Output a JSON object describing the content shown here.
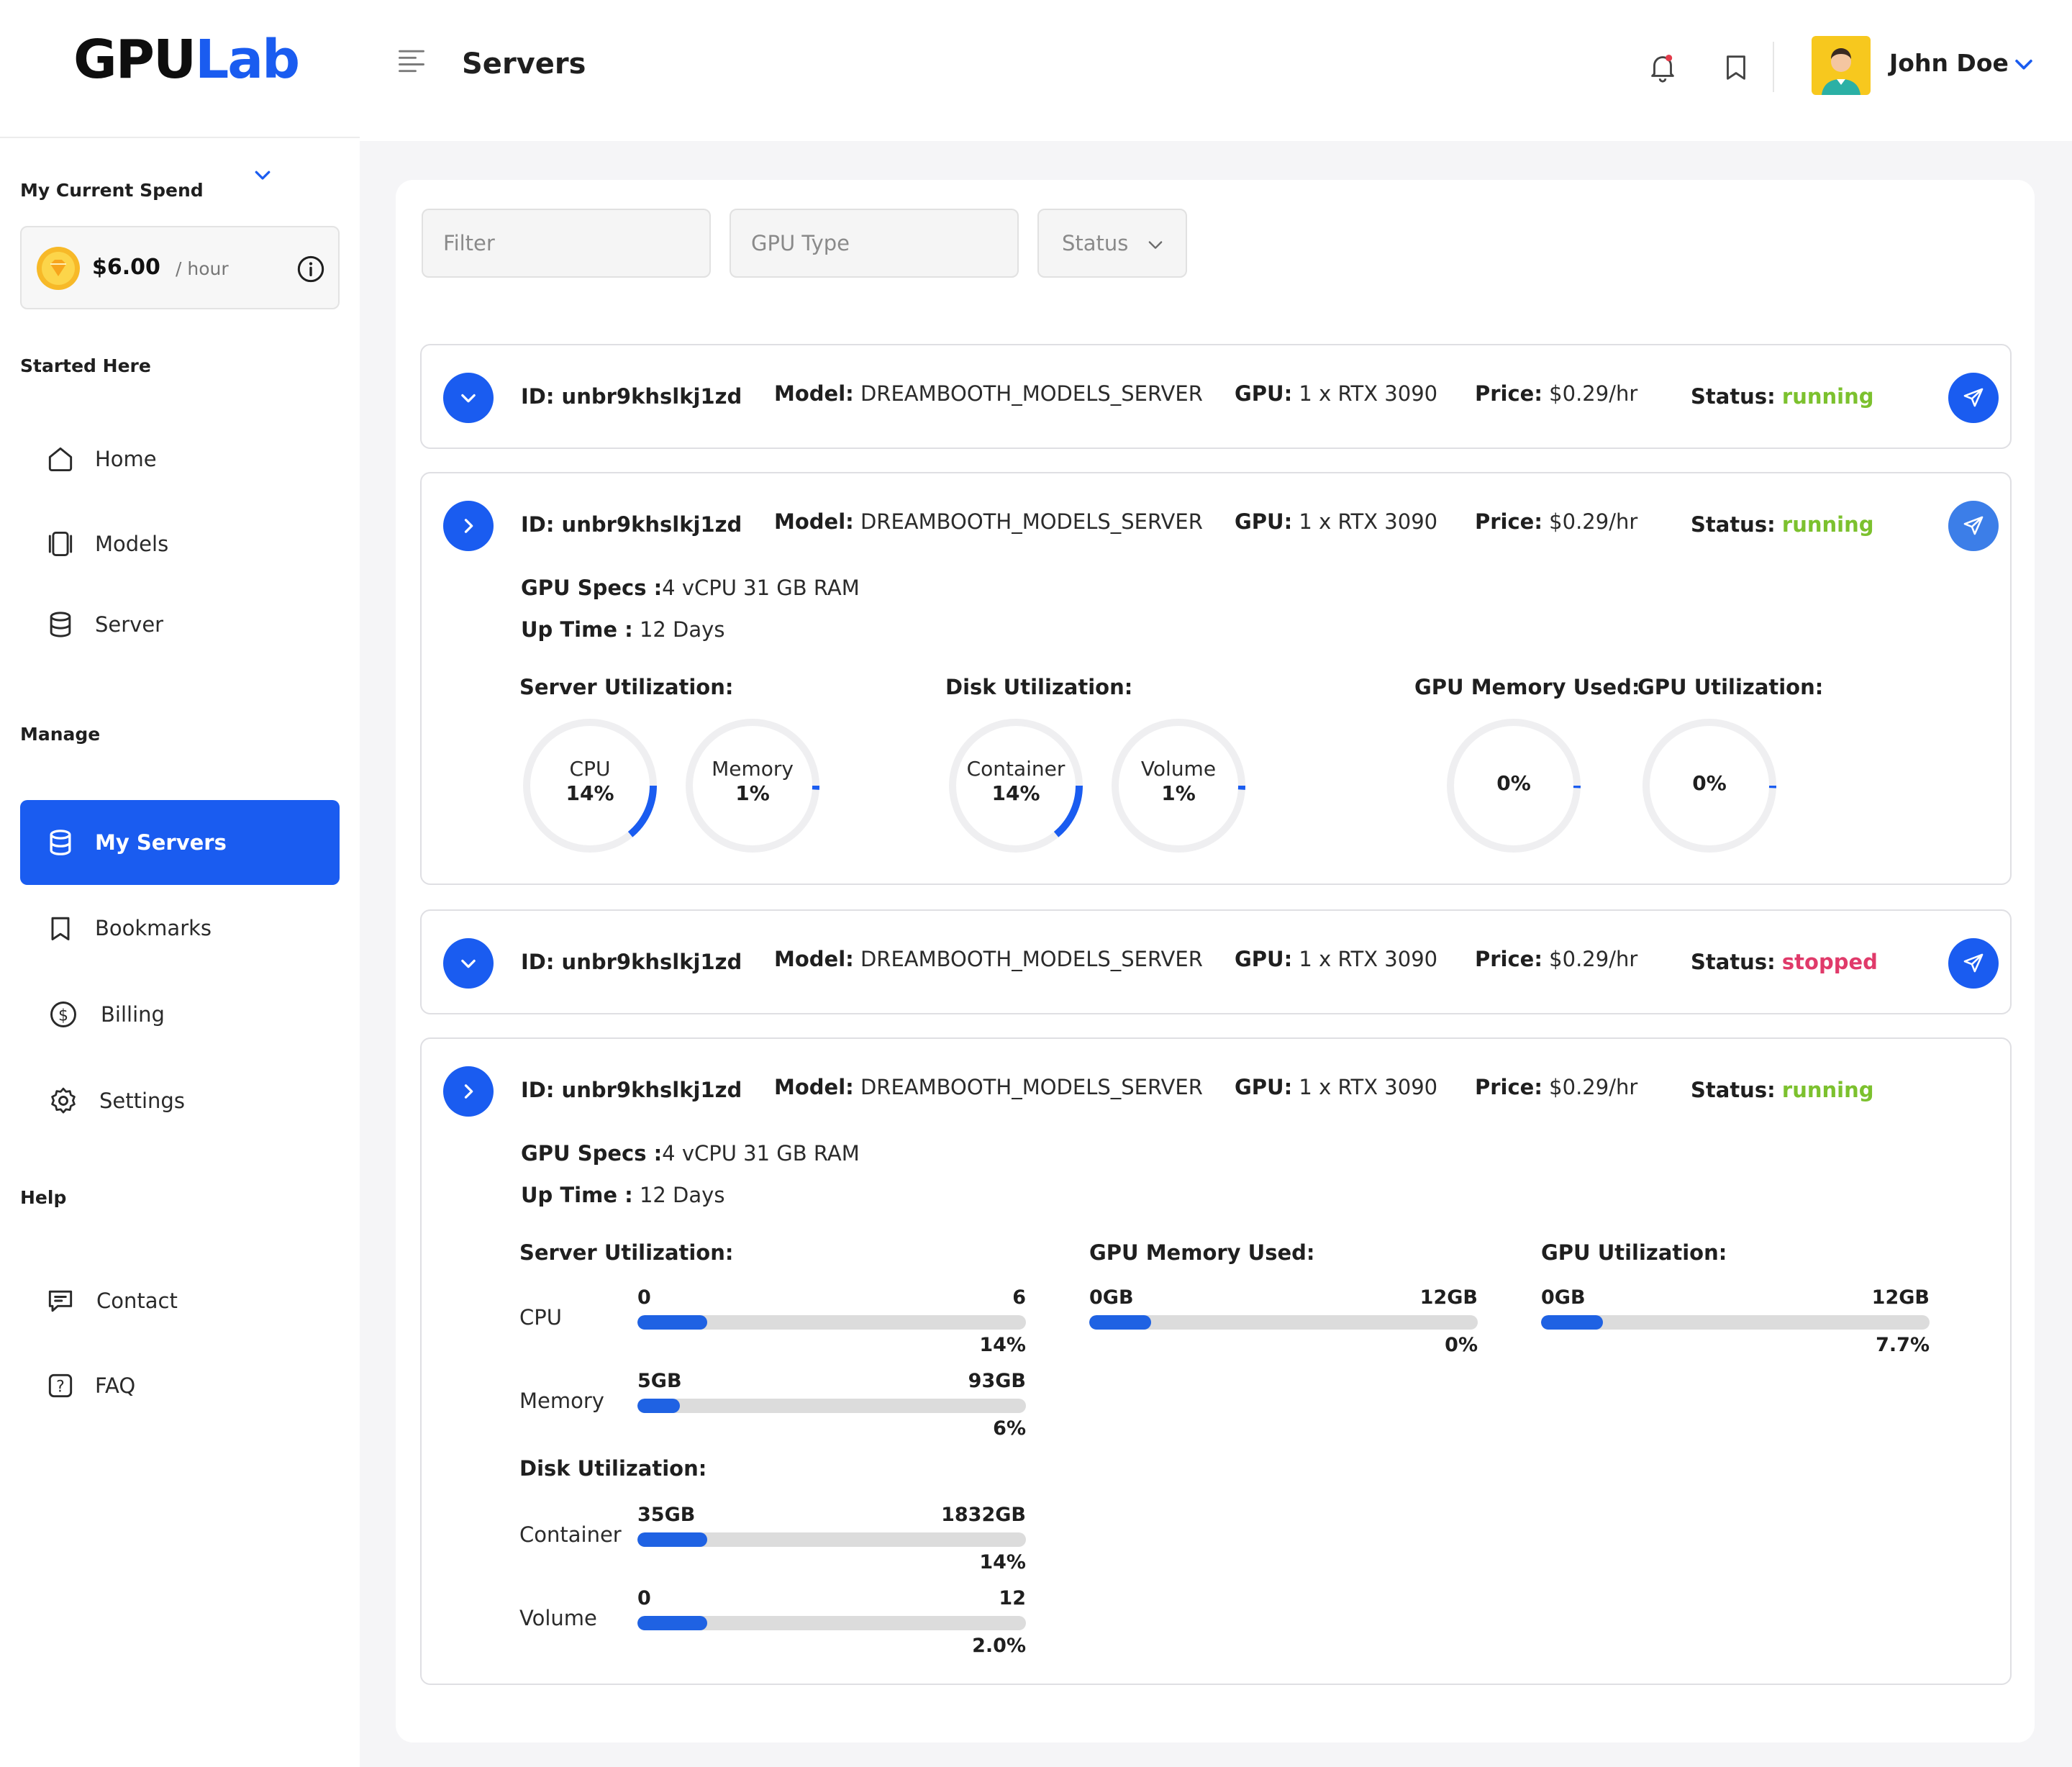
{
  "brand": {
    "name_part1": "GPU",
    "name_part2": "Lab"
  },
  "header": {
    "title": "Servers",
    "user_name": "John Doe"
  },
  "spend": {
    "title": "My Current Spend",
    "amount": "$6.00",
    "unit": "/ hour"
  },
  "sidebar": {
    "started_label": "Started Here",
    "manage_label": "Manage",
    "help_label": "Help",
    "items": [
      {
        "label": "Home",
        "icon": "home-icon"
      },
      {
        "label": "Models",
        "icon": "models-icon"
      },
      {
        "label": "Server",
        "icon": "database-icon"
      },
      {
        "label": "My Servers",
        "icon": "database-icon",
        "active": true
      },
      {
        "label": "Bookmarks",
        "icon": "bookmark-icon"
      },
      {
        "label": "Billing",
        "icon": "dollar-icon"
      },
      {
        "label": "Settings",
        "icon": "gear-icon"
      },
      {
        "label": "Contact",
        "icon": "chat-icon"
      },
      {
        "label": "FAQ",
        "icon": "question-icon"
      }
    ]
  },
  "filters": {
    "filter_placeholder": "Filter",
    "gpu_type_placeholder": "GPU Type",
    "status_label": "Status"
  },
  "labels": {
    "model": "Model:",
    "gpu": "GPU:",
    "price": "Price:",
    "status": "Status:",
    "gpu_specs": "GPU Specs :",
    "up_time": "Up Time :",
    "server_util": "Server Utilization:",
    "disk_util": "Disk Utilization:",
    "gpu_mem_used": "GPU Memory Used:",
    "gpu_util": "GPU Utilization:"
  },
  "servers": [
    {
      "id": "ID: unbr9khslkj1zd",
      "model": "DREAMBOOTH_MODELS_SERVER",
      "gpu": "1 x RTX 3090",
      "price": "$0.29/hr",
      "status": "running"
    },
    {
      "id": "ID: unbr9khslkj1zd",
      "model": "DREAMBOOTH_MODELS_SERVER",
      "gpu": "1 x RTX 3090",
      "price": "$0.29/hr",
      "status": "running",
      "gpu_specs": "4 vCPU 31 GB RAM",
      "up_time": "12 Days",
      "gauges": {
        "cpu": {
          "label": "CPU",
          "value": "14%",
          "fraction": 0.14
        },
        "memory": {
          "label": "Memory",
          "value": "1%",
          "fraction": 0.01
        },
        "container": {
          "label": "Container",
          "value": "14%",
          "fraction": 0.14
        },
        "volume": {
          "label": "Volume",
          "value": "1%",
          "fraction": 0.01
        },
        "gpu_memory": {
          "value": "0%",
          "fraction": 0.0
        },
        "gpu_util": {
          "value": "0%",
          "fraction": 0.0
        }
      }
    },
    {
      "id": "ID: unbr9khslkj1zd",
      "model": "DREAMBOOTH_MODELS_SERVER",
      "gpu": "1 x RTX 3090",
      "price": "$0.29/hr",
      "status": "stopped"
    },
    {
      "id": "ID: unbr9khslkj1zd",
      "model": "DREAMBOOTH_MODELS_SERVER",
      "gpu": "1 x RTX 3090",
      "price": "$0.29/hr",
      "status": "running",
      "gpu_specs": "4 vCPU 31 GB RAM",
      "up_time": "12 Days",
      "bars": {
        "cpu": {
          "label": "CPU",
          "min": "0",
          "max": "6",
          "pct": "14%",
          "fraction": 0.18
        },
        "memory": {
          "label": "Memory",
          "min": "5GB",
          "max": "93GB",
          "pct": "6%",
          "fraction": 0.11
        },
        "container": {
          "label": "Container",
          "min": "35GB",
          "max": "1832GB",
          "pct": "14%",
          "fraction": 0.18
        },
        "volume": {
          "label": "Volume",
          "min": "0",
          "max": "12",
          "pct": "2.0%",
          "fraction": 0.18
        },
        "gpu_memory": {
          "min": "0GB",
          "max": "12GB",
          "pct": "0%",
          "fraction": 0.16
        },
        "gpu_util": {
          "min": "0GB",
          "max": "12GB",
          "pct": "7.7%",
          "fraction": 0.16
        }
      }
    }
  ],
  "colors": {
    "accent": "#1a5cf0",
    "running": "#7cc12e",
    "stopped": "#e03a6a",
    "track": "#dcdcdc"
  }
}
